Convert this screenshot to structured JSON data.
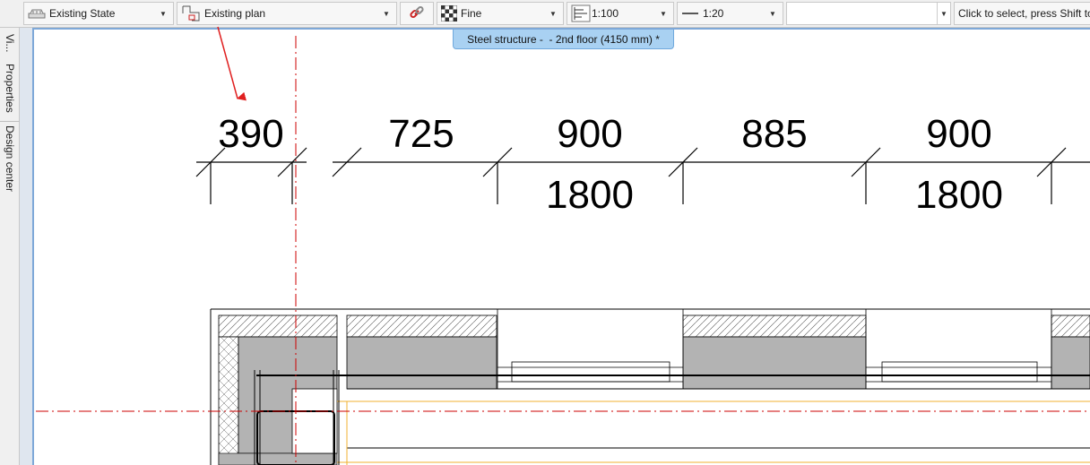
{
  "toolbar": {
    "state": {
      "label": "Existing State",
      "icon": "layers-icon"
    },
    "plan": {
      "label": "Existing plan",
      "icon": "plan-icon"
    },
    "link_icon": "link-icon",
    "detail": {
      "label": "Fine",
      "icon": "checker-icon"
    },
    "scale": {
      "label": "1:100",
      "icon": "scale-icon"
    },
    "line_scale": {
      "label": "1:20",
      "icon": "line-icon"
    },
    "search": {
      "value": ""
    },
    "status": "Click to select, press Shift to"
  },
  "side_panel": {
    "tabs": [
      "Vi...",
      "Properties",
      "Design center"
    ]
  },
  "document_tab": {
    "title": "Steel structure -  - 2nd floor (4150 mm) *"
  },
  "dimensions": {
    "top_row": [
      "390",
      "725",
      "900",
      "885",
      "900"
    ],
    "bottom_row": [
      "1800",
      "1800"
    ]
  },
  "colors": {
    "accent": "#2f6fb4",
    "tab_active": "#a9d1f2",
    "annotation_arrow": "#e02020",
    "axis_line": "#cc0000",
    "wall_fill": "#b3b3b3",
    "column_outline": "#f0b030"
  }
}
